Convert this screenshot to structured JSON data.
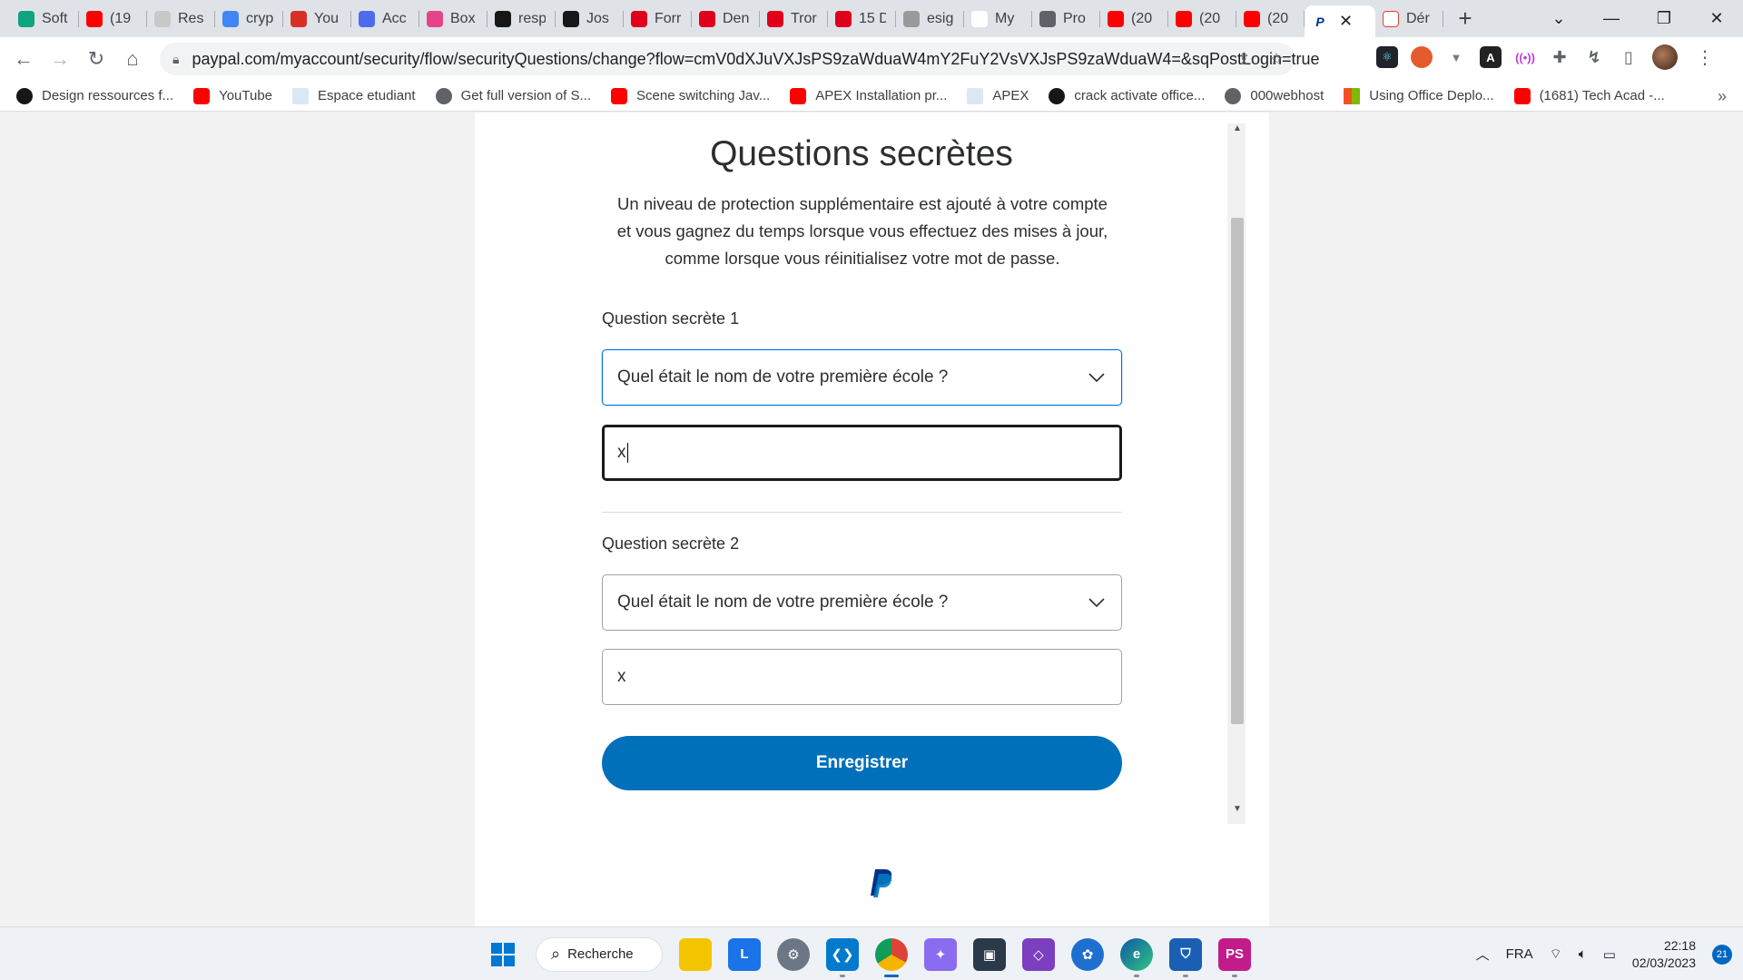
{
  "browser": {
    "tabs": [
      {
        "label": "Soft",
        "icon": "openai-icon",
        "color": "#10a37f"
      },
      {
        "label": "(19",
        "icon": "youtube-icon",
        "color": "#ff0000"
      },
      {
        "label": "Res",
        "icon": "page-icon",
        "color": "#c8c8c8"
      },
      {
        "label": "cryp",
        "icon": "google-icon",
        "color": "#4285f4"
      },
      {
        "label": "You",
        "icon": "gmail-icon",
        "color": "#d93025"
      },
      {
        "label": "Acc",
        "icon": "copilot-icon",
        "color": "#4f6bed"
      },
      {
        "label": "Box",
        "icon": "box-icon",
        "color": "#e6448a"
      },
      {
        "label": "resp",
        "icon": "github-icon",
        "color": "#181717"
      },
      {
        "label": "Jos",
        "icon": "github-icon",
        "color": "#181717"
      },
      {
        "label": "Forr",
        "icon": "tn-icon",
        "color": "#e0001b"
      },
      {
        "label": "Den",
        "icon": "tn-icon",
        "color": "#e0001b"
      },
      {
        "label": "Tror",
        "icon": "tn-icon",
        "color": "#e0001b"
      },
      {
        "label": "15 D",
        "icon": "tn-icon",
        "color": "#e0001b"
      },
      {
        "label": "esig",
        "icon": "tn-icon",
        "color": "#9a9a9a"
      },
      {
        "label": "My",
        "icon": "cv-icon",
        "color": "#ffffff"
      },
      {
        "label": "Pro",
        "icon": "globe-icon",
        "color": "#5f6368"
      },
      {
        "label": "(20",
        "icon": "youtube-icon",
        "color": "#ff0000"
      },
      {
        "label": "(20",
        "icon": "youtube-icon",
        "color": "#ff0000"
      },
      {
        "label": "(20",
        "icon": "youtube-icon",
        "color": "#ff0000"
      }
    ],
    "active_tab_icon": "paypal-icon",
    "after_tab": {
      "label": "Dér",
      "icon": "meet-icon"
    },
    "url": "paypal.com/myaccount/security/flow/securityQuestions/change?flow=cmV0dXJuVXJsPS9zaWduaW4mY2FuY2VsVXJsPS9zaWduaW4=&sqPostLogin=true",
    "bookmarks": [
      {
        "label": "Design ressources f...",
        "icon": "gh"
      },
      {
        "label": "YouTube",
        "icon": "yt"
      },
      {
        "label": "Espace etudiant",
        "icon": "doc"
      },
      {
        "label": "Get full version of S...",
        "icon": "globe"
      },
      {
        "label": "Scene switching Jav...",
        "icon": "yt"
      },
      {
        "label": "APEX Installation pr...",
        "icon": "yt"
      },
      {
        "label": "APEX",
        "icon": "doc"
      },
      {
        "label": "crack activate office...",
        "icon": "gh"
      },
      {
        "label": "000webhost",
        "icon": "globe"
      },
      {
        "label": "Using Office Deplo...",
        "icon": "ms"
      },
      {
        "label": "(1681) Tech Acad -...",
        "icon": "yt"
      }
    ],
    "bookmarks_more": "»"
  },
  "form": {
    "title": "Questions secrètes",
    "description_lines": [
      "Un niveau de protection supplémentaire est ajouté à votre compte",
      "et vous gagnez du temps lorsque vous effectuez des mises à jour,",
      "comme lorsque vous réinitialisez votre mot de passe."
    ],
    "q1": {
      "label": "Question secrète 1",
      "selected": "Quel était le nom de votre première école ?",
      "answer": "x"
    },
    "q2": {
      "label": "Question secrète 2",
      "selected": "Quel était le nom de votre première école ?",
      "answer": "x"
    },
    "save_label": "Enregistrer"
  },
  "taskbar": {
    "search_label": "Recherche",
    "language": "FRA",
    "time": "22:18",
    "date": "02/03/2023",
    "notification_count": "21"
  },
  "colors": {
    "paypal_blue": "#0070ba",
    "focus_blue": "#0070e0",
    "text_dark": "#2c2e2f"
  }
}
